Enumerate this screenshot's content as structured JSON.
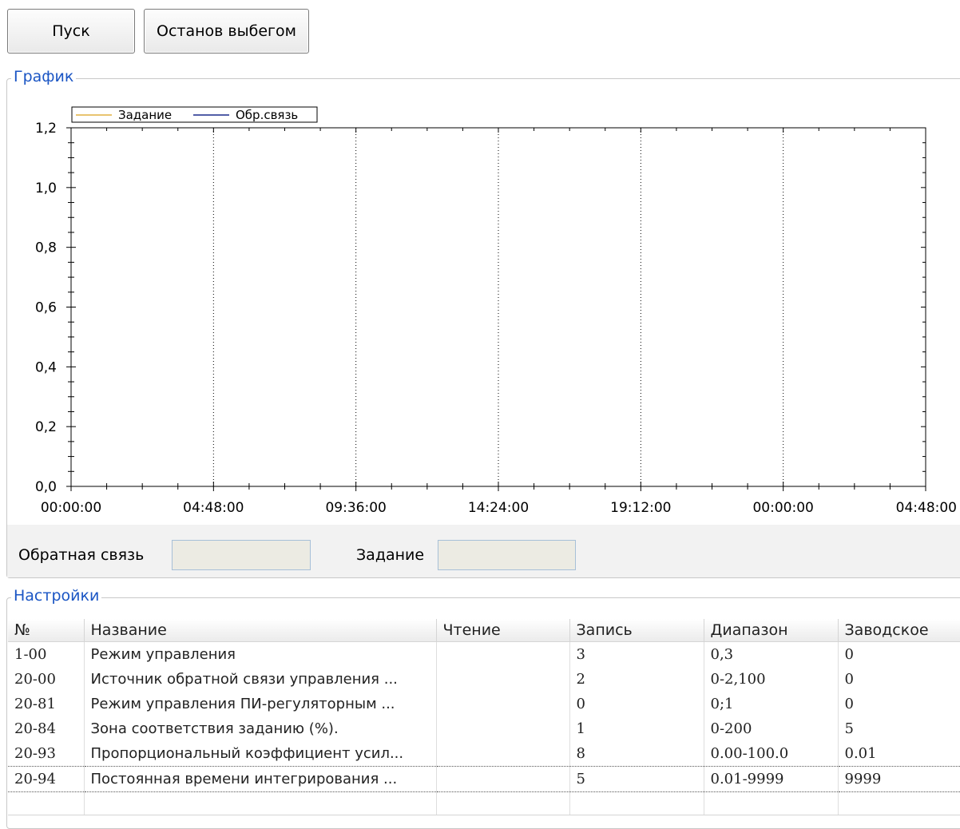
{
  "toolbar": {
    "start_label": "Пуск",
    "coast_stop_label": "Останов выбегом"
  },
  "chart_panel": {
    "title": "График",
    "feedback_label": "Обратная связь",
    "feedback_value": "",
    "setpoint_label": "Задание",
    "setpoint_value": ""
  },
  "chart_data": {
    "type": "line",
    "title": "",
    "xlabel": "",
    "ylabel": "",
    "x_ticks": [
      "00:00:00",
      "04:48:00",
      "09:36:00",
      "14:24:00",
      "19:12:00",
      "00:00:00",
      "04:48:00"
    ],
    "y_ticks": [
      "0,0",
      "0,2",
      "0,4",
      "0,6",
      "0,8",
      "1,0",
      "1,2"
    ],
    "ylim": [
      0,
      1.2
    ],
    "grid": "vertical dotted",
    "legend_position": "top-left",
    "series": [
      {
        "name": "Задание",
        "color": "#e0b040",
        "values": []
      },
      {
        "name": "Обр.связь",
        "color": "#1a2a8c",
        "values": []
      }
    ]
  },
  "settings_panel": {
    "title": "Настройки",
    "columns": [
      "№",
      "Название",
      "Чтение",
      "Запись",
      "Диапазон",
      "Заводское"
    ],
    "rows": [
      {
        "no": "1-00",
        "name": "Режим управления",
        "read": "",
        "write": "3",
        "range": "0,3",
        "factory": "0"
      },
      {
        "no": "20-00",
        "name": "Источник обратной связи управления ...",
        "read": "",
        "write": "2",
        "range": "0-2,100",
        "factory": "0"
      },
      {
        "no": "20-81",
        "name": "Режим управления ПИ-регуляторным ...",
        "read": "",
        "write": "0",
        "range": "0;1",
        "factory": "0"
      },
      {
        "no": "20-84",
        "name": "Зона соответствия заданию (%).",
        "read": "",
        "write": "1",
        "range": "0-200",
        "factory": "5"
      },
      {
        "no": "20-93",
        "name": "Пропорциональный коэффициент усил...",
        "read": "",
        "write": "8",
        "range": "0.00-100.0",
        "factory": "0.01"
      },
      {
        "no": "20-94",
        "name": "Постоянная времени интегрирования ...",
        "read": "",
        "write": "5",
        "range": "0.01-9999",
        "factory": "9999"
      }
    ]
  }
}
